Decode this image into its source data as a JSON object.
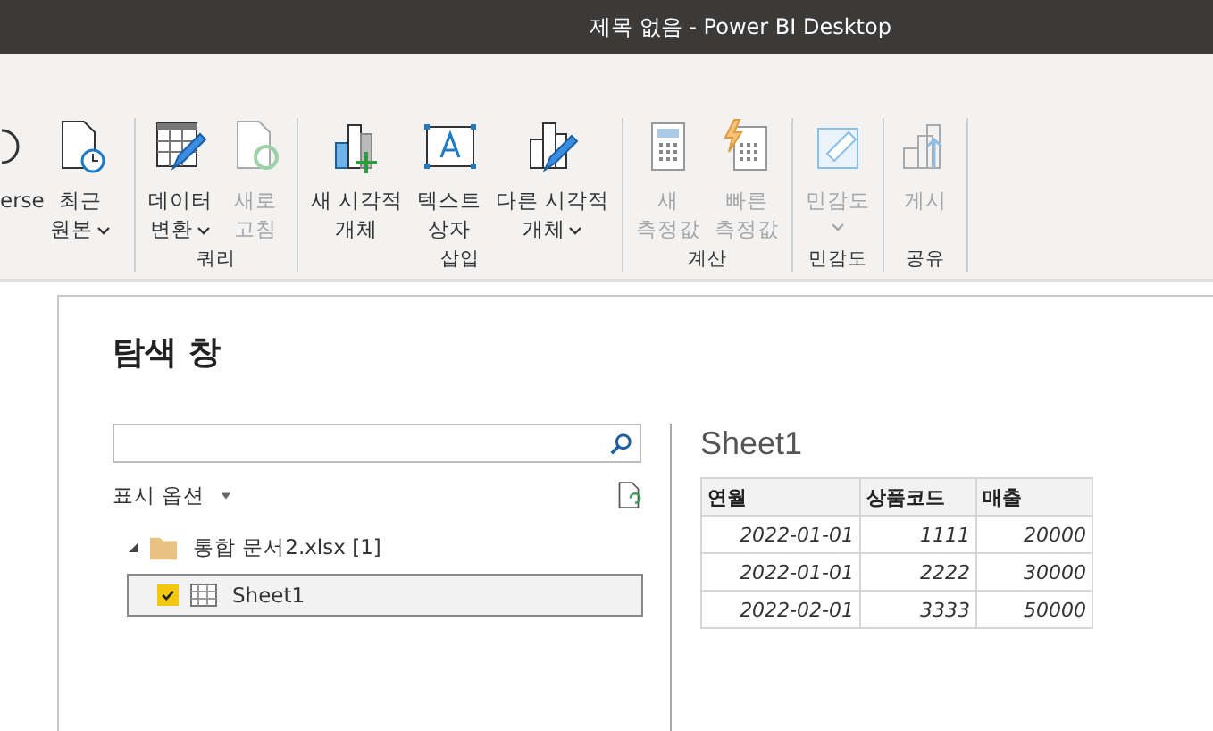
{
  "window": {
    "title": "제목 없음 - Power BI Desktop"
  },
  "ribbon": {
    "groups": [
      {
        "buttons": [
          {
            "lines": [
              "erse"
            ],
            "disabled": false,
            "dropdown": false,
            "kind": "partial"
          }
        ]
      },
      {
        "buttons": [
          {
            "lines": [
              "최근",
              "원본"
            ],
            "disabled": false,
            "dropdown": true,
            "kind": "recent"
          }
        ]
      },
      {
        "label": "쿼리",
        "buttons": [
          {
            "lines": [
              "데이터",
              "변환"
            ],
            "disabled": false,
            "dropdown": true,
            "kind": "transform"
          },
          {
            "lines": [
              "새로",
              "고침"
            ],
            "disabled": true,
            "dropdown": false,
            "kind": "refresh"
          }
        ]
      },
      {
        "label": "삽입",
        "buttons": [
          {
            "lines": [
              "새 시각적",
              "개체"
            ],
            "disabled": false,
            "dropdown": false,
            "kind": "visual"
          },
          {
            "lines": [
              "텍스트",
              "상자"
            ],
            "disabled": false,
            "dropdown": false,
            "kind": "textbox"
          },
          {
            "lines": [
              "다른 시각적",
              "개체"
            ],
            "disabled": false,
            "dropdown": true,
            "kind": "morevisual"
          }
        ]
      },
      {
        "label": "계산",
        "buttons": [
          {
            "lines": [
              "새",
              "측정값"
            ],
            "disabled": true,
            "dropdown": false,
            "kind": "measure"
          },
          {
            "lines": [
              "빠른",
              "측정값"
            ],
            "disabled": true,
            "dropdown": false,
            "kind": "quickmeasure"
          }
        ]
      },
      {
        "label": "민감도",
        "buttons": [
          {
            "lines": [
              "민감도"
            ],
            "disabled": true,
            "dropdown": true,
            "kind": "sensitivity"
          }
        ]
      },
      {
        "label": "공유",
        "buttons": [
          {
            "lines": [
              "게시"
            ],
            "disabled": true,
            "dropdown": false,
            "kind": "publish"
          }
        ]
      }
    ]
  },
  "navigator": {
    "title": "탐색 창",
    "display_options": "표시 옵션",
    "tree": [
      {
        "label": "통합 문서2.xlsx [1]",
        "expanded": true,
        "children": [
          {
            "label": "Sheet1",
            "checked": true,
            "selected": true
          }
        ]
      }
    ],
    "preview": {
      "title": "Sheet1",
      "columns": [
        "연월",
        "상품코드",
        "매출"
      ],
      "rows": [
        [
          "2022-01-01",
          "1111",
          "20000"
        ],
        [
          "2022-01-01",
          "2222",
          "30000"
        ],
        [
          "2022-02-01",
          "3333",
          "50000"
        ]
      ]
    }
  }
}
